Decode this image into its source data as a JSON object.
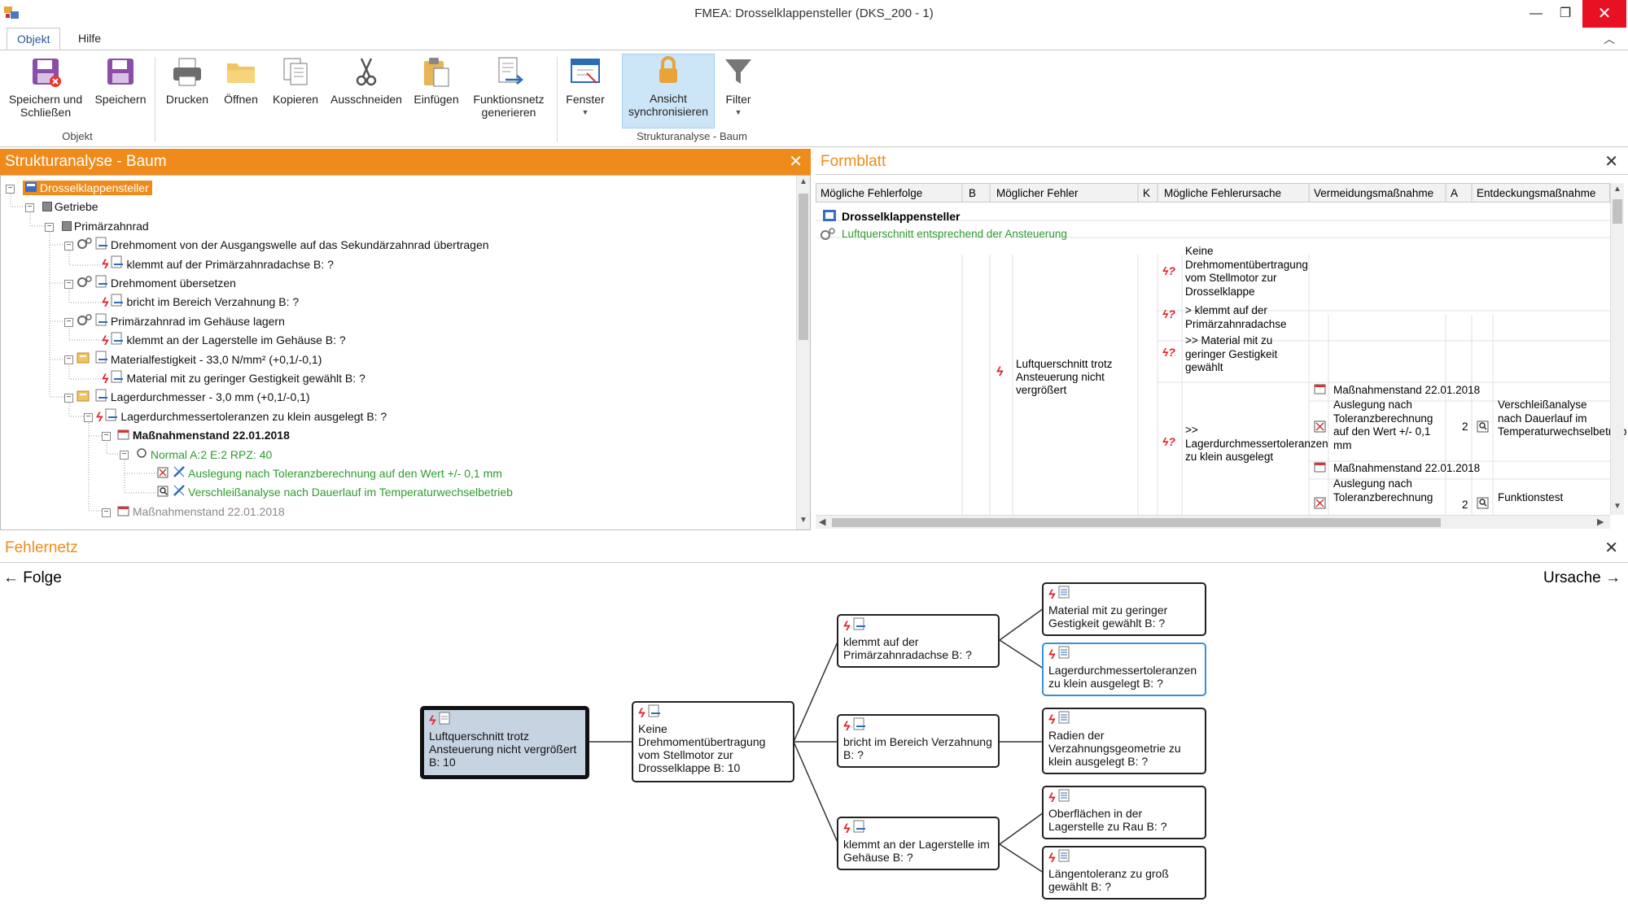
{
  "window": {
    "title": "FMEA: Drosselklappensteller (DKS_200 - 1)"
  },
  "ribbon": {
    "tabs": [
      "Objekt",
      "Hilfe"
    ],
    "buttons": {
      "save_close": "Speichern und Schließen",
      "save": "Speichern",
      "print": "Drucken",
      "open": "Öffnen",
      "copy": "Kopieren",
      "cut": "Ausschneiden",
      "paste": "Einfügen",
      "funcnet": "Funktionsnetz generieren",
      "window": "Fenster",
      "sync": "Ansicht synchronisieren",
      "filter": "Filter"
    },
    "groups": {
      "objekt": "Objekt",
      "struktur": "Strukturanalyse - Baum"
    }
  },
  "struct": {
    "title": "Strukturanalyse - Baum",
    "rows": [
      "Drosselklappensteller",
      "Getriebe",
      "Primärzahnrad",
      "Drehmoment von der Ausgangswelle auf das Sekundärzahnrad übertragen",
      "klemmt auf der Primärzahnradachse B: ?",
      "Drehmoment übersetzen",
      "bricht im Bereich Verzahnung B: ?",
      "Primärzahnrad im Gehäuse lagern",
      "klemmt an der Lagerstelle im Gehäuse B: ?",
      "Materialfestigkeit - 33,0 N/mm² (+0,1/-0,1)",
      "Material mit zu geringer Gestigkeit gewählt B: ?",
      "Lagerdurchmesser - 3,0 mm (+0,1/-0,1)",
      "Lagerdurchmessertoleranzen zu klein ausgelegt B: ?",
      "Maßnahmenstand 22.01.2018",
      "Normal A:2 E:2 RPZ: 40",
      "Auslegung nach Toleranzberechnung auf den Wert +/- 0,1 mm",
      "Verschleißanalyse nach Dauerlauf im Temperaturwechselbetrieb",
      "Maßnahmenstand 22.01.2018"
    ]
  },
  "form": {
    "title": "Formblatt",
    "headers": [
      "Mögliche Fehlerfolge",
      "B",
      "Möglicher Fehler",
      "K",
      "Mögliche Fehlerursache",
      "Vermeidungsmaßnahme",
      "A",
      "Entdeckungsmaßnahme"
    ],
    "object": "Drosselklappensteller",
    "function": "Luftquerschnitt entsprechend der Ansteuerung",
    "fehler": "Luftquerschnitt trotz Ansteuerung nicht vergrößert",
    "ursachen": [
      "Keine Drehmomentübertragung vom Stellmotor zur Drosselklappe",
      "> klemmt auf der Primärzahnradachse",
      ">> Material mit zu geringer Gestigkeit gewählt",
      ">> Lagerdurchmessertoleranzen zu klein ausgelegt"
    ],
    "massnahmenstand": "Maßnahmenstand 22.01.2018",
    "vermeidung1": "Auslegung nach Toleranzberechnung auf den Wert +/- 0,1 mm",
    "a1": "2",
    "entdeckung1": "Verschleißanalyse nach Dauerlauf im Temperaturwechselbetrieb",
    "massnahmenstand2": "Maßnahmenstand 22.01.2018",
    "vermeidung2": "Auslegung nach Toleranzberechnung",
    "a2": "2",
    "entdeckung2": "Funktionstest"
  },
  "net": {
    "title": "Fehlernetz",
    "left_label": "← Folge",
    "right_label": "Ursache →",
    "nodes": {
      "focus": "Luftquerschnitt trotz Ansteuerung nicht vergrößert B: 10",
      "keine": "Keine Drehmomentübertragung vom Stellmotor zur Drosselklappe B: 10",
      "klemmt_achse": "klemmt auf der Primärzahnradachse B: ?",
      "bricht": "bricht im Bereich Verzahnung B: ?",
      "klemmt_lager": "klemmt an der Lagerstelle im Gehäuse B: ?",
      "material": "Material mit zu geringer Gestigkeit gewählt B: ?",
      "lagerdm": "Lagerdurchmessertoleranzen zu klein ausgelegt B: ?",
      "radien": "Radien der Verzahnungsgeometrie zu klein ausgelegt B: ?",
      "oberfl": "Oberflächen in der Lagerstelle zu Rau B: ?",
      "laenge": "Längentoleranz zu groß gewählt B: ?"
    }
  }
}
